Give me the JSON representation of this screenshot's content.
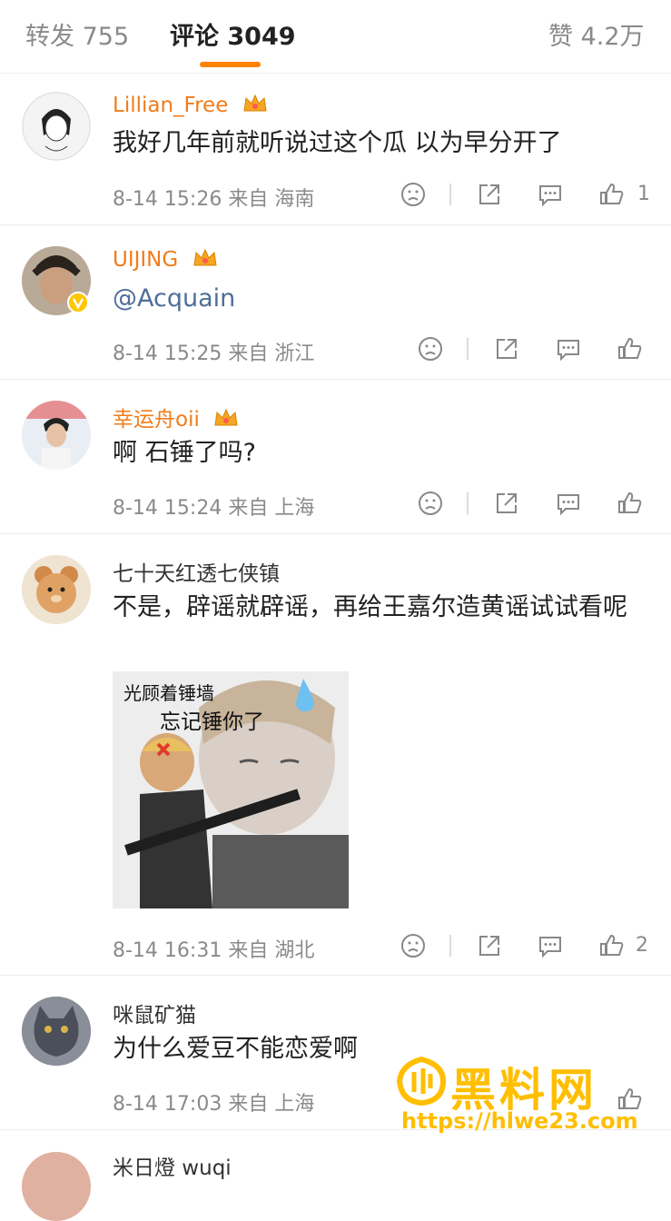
{
  "tabs": {
    "repost": "转发 755",
    "comments": "评论 3049",
    "likes": "赞 4.2万"
  },
  "comments": [
    {
      "username": "Lillian_Free",
      "text": "我好几年前就听说过这个瓜 以为早分开了",
      "time": "8-14 15:26",
      "location": "来自 海南",
      "likes": "1"
    },
    {
      "username": "UIJING",
      "text": "@Acquain",
      "time": "8-14 15:25",
      "location": "来自 浙江",
      "likes": ""
    },
    {
      "username": "幸运舟oii",
      "text": "啊 石锤了吗?",
      "time": "8-14 15:24",
      "location": "来自 上海",
      "likes": ""
    },
    {
      "username": "七十天红透七侠镇",
      "text": "不是，辟谣就辟谣，再给王嘉尔造黄谣试试看呢",
      "image_caption_1": "光顾着锤墙",
      "image_caption_2": "忘记锤你了",
      "time": "8-14 16:31",
      "location": "来自 湖北",
      "likes": "2"
    },
    {
      "username": "咪鼠矿猫",
      "text": "为什么爱豆不能恋爱啊",
      "time": "8-14 17:03",
      "location": "来自 上海",
      "likes": ""
    },
    {
      "username": "米日燈 wuqi"
    }
  ],
  "watermark": {
    "title": "黑料网",
    "url": "https://hlwe23.com"
  },
  "colors": {
    "accent": "#ff8200",
    "vip_name": "#f07c1b",
    "mention": "#4f6e98"
  }
}
